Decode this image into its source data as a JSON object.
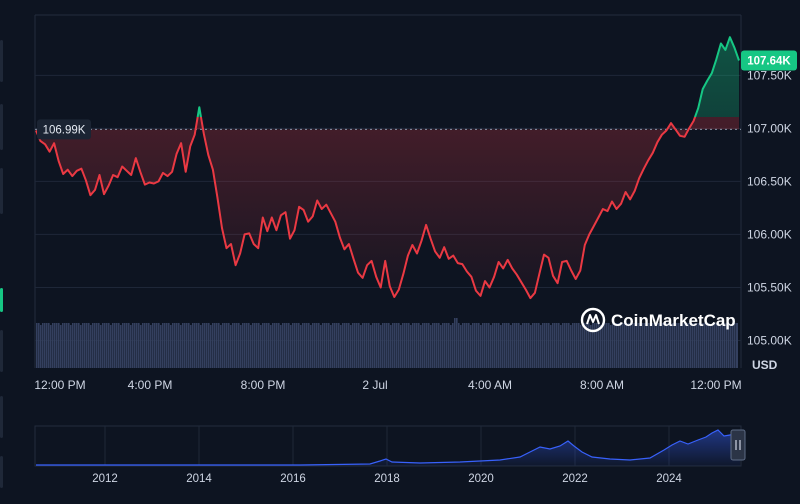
{
  "chart_data": {
    "type": "line",
    "main": {
      "ylim": [
        104750,
        108050
      ],
      "y_ticks": [
        "107.50K",
        "107.00K",
        "106.50K",
        "106.00K",
        "105.50K",
        "105.00K"
      ],
      "y_tick_values": [
        107500,
        107000,
        106500,
        106000,
        105500,
        105000
      ],
      "x_ticks": [
        "12:00 PM",
        "4:00 PM",
        "8:00 PM",
        "2 Jul",
        "4:00 AM",
        "8:00 AM",
        "12:00 PM"
      ],
      "reference_label": "106.99K",
      "reference_value": 106990,
      "current_label": "107.64K",
      "unit": "USD",
      "above_color": "#16c784",
      "below_color": "#ea3943",
      "series": [
        {
          "values": [
            106980,
            106880,
            106850,
            106780,
            106860,
            106690,
            106570,
            106610,
            106550,
            106600,
            106620,
            106510,
            106370,
            106420,
            106560,
            106380,
            106460,
            106560,
            106540,
            106640,
            106600,
            106560,
            106720,
            106590,
            106470,
            106490,
            106480,
            106500,
            106580,
            106550,
            106590,
            106760,
            106860,
            106590,
            106830,
            106940,
            107200,
            106950,
            106750,
            106610,
            106350,
            106060,
            105870,
            105910,
            105710,
            105820,
            106000,
            106010,
            105910,
            105870,
            106160,
            106030,
            106160,
            106040,
            106180,
            106210,
            105960,
            106040,
            106260,
            106230,
            106120,
            106170,
            106320,
            106240,
            106280,
            106200,
            106120,
            105970,
            105860,
            105910,
            105770,
            105640,
            105590,
            105710,
            105750,
            105600,
            105500,
            105750,
            105510,
            105410,
            105480,
            105630,
            105800,
            105900,
            105820,
            105940,
            106090,
            105960,
            105840,
            105780,
            105880,
            105770,
            105800,
            105730,
            105720,
            105650,
            105600,
            105470,
            105420,
            105560,
            105500,
            105600,
            105740,
            105680,
            105760,
            105680,
            105620,
            105550,
            105480,
            105400,
            105450,
            105630,
            105810,
            105780,
            105610,
            105540,
            105740,
            105750,
            105660,
            105580,
            105660,
            105900,
            106000,
            106080,
            106160,
            106240,
            106220,
            106310,
            106240,
            106290,
            106400,
            106330,
            106410,
            106530,
            106620,
            106700,
            106770,
            106870,
            106940,
            106980,
            107050,
            106990,
            106930,
            106920,
            107000,
            107070,
            107190,
            107370,
            107450,
            107520,
            107650,
            107800,
            107740,
            107860,
            107760,
            107640
          ]
        }
      ]
    },
    "overview": {
      "x_ticks": [
        "2012",
        "2014",
        "2016",
        "2018",
        "2020",
        "2022",
        "2024"
      ]
    },
    "watermark": "CoinMarketCap"
  }
}
